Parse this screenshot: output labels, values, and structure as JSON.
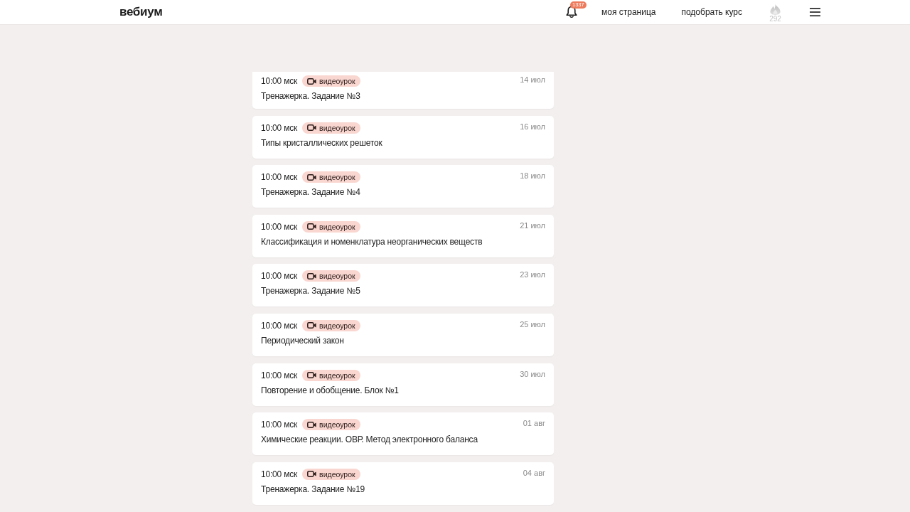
{
  "header": {
    "logo": "вебиум",
    "notifications": {
      "count": "1337"
    },
    "nav": [
      "моя страница",
      "подобрать курс"
    ],
    "points": "292"
  },
  "lessons": [
    {
      "time": "10:00 мск",
      "badge": "видеоурок",
      "date": "14 июл",
      "title": "Тренажерка. Задание №3"
    },
    {
      "time": "10:00 мск",
      "badge": "видеоурок",
      "date": "16 июл",
      "title": "Типы кристаллических решеток"
    },
    {
      "time": "10:00 мск",
      "badge": "видеоурок",
      "date": "18 июл",
      "title": "Тренажерка. Задание №4"
    },
    {
      "time": "10:00 мск",
      "badge": "видеоурок",
      "date": "21 июл",
      "title": "Классификация и номенклатура неорганических веществ"
    },
    {
      "time": "10:00 мск",
      "badge": "видеоурок",
      "date": "23 июл",
      "title": "Тренажерка. Задание №5"
    },
    {
      "time": "10:00 мск",
      "badge": "видеоурок",
      "date": "25 июл",
      "title": "Периодический закон"
    },
    {
      "time": "10:00 мск",
      "badge": "видеоурок",
      "date": "30 июл",
      "title": "Повторение и обобщение. Блок №1"
    },
    {
      "time": "10:00 мск",
      "badge": "видеоурок",
      "date": "01 авг",
      "title": "Химические реакции. ОВР. Метод электронного баланса"
    },
    {
      "time": "10:00 мск",
      "badge": "видеоурок",
      "date": "04 авг",
      "title": "Тренажерка. Задание №19"
    }
  ]
}
